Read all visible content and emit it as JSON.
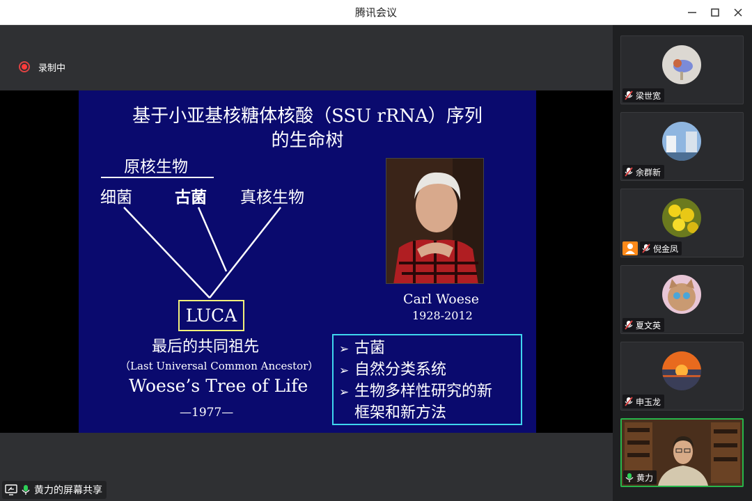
{
  "window": {
    "title": "腾讯会议"
  },
  "recording": {
    "label": "录制中"
  },
  "slide": {
    "title_line1": "基于小亚基核糖体核酸（SSU rRNA）序列",
    "title_line2": "的生命树",
    "prokaryote": "原核生物",
    "bacteria": "细菌",
    "archaea": "古菌",
    "eukaryote": "真核生物",
    "luca": "LUCA",
    "luca_zh": "最后的共同祖先",
    "luca_en": "（Last Universal Common Ancestor）",
    "tree_name": "Woese’s Tree of Life",
    "tree_year": "—1977—",
    "photo_name": "Carl Woese",
    "photo_years": "1928-2012",
    "bullets": [
      "古菌",
      "自然分类系统",
      "生物多样性研究的新",
      "框架和新方法"
    ]
  },
  "share": {
    "label": "黄力的屏幕共享"
  },
  "participants": [
    {
      "name": "梁世宽"
    },
    {
      "name": "余群新"
    },
    {
      "name": "倪金凤"
    },
    {
      "name": "夏文英"
    },
    {
      "name": "申玉龙"
    },
    {
      "name": "黄力"
    }
  ],
  "colors": {
    "slide_bg": "#0a0a6e",
    "luca_border": "#f2f07a",
    "bullet_border": "#3fd6ee",
    "active_speaker": "#27b64b",
    "recording": "#ff3b3b",
    "mic_muted": "#e04343"
  }
}
